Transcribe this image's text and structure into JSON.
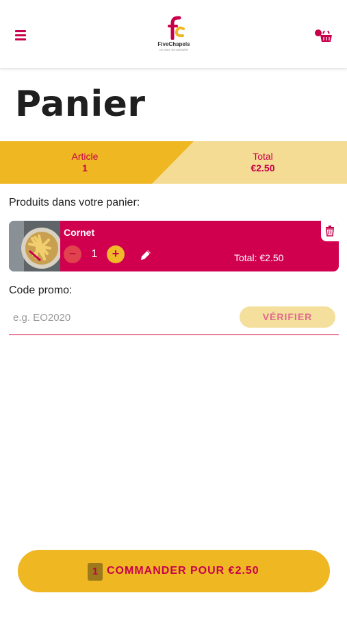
{
  "colors": {
    "brand_primary": "#c8004b",
    "brand_accent": "#efb722",
    "banner_light": "#f5dc94",
    "card_bg": "#d1004f"
  },
  "header": {
    "menu_icon": "hamburger-icon",
    "logo_name": "FiveChapels",
    "logo_tagline": "NO WAY, NO ANSWER",
    "cart_icon": "basket-icon"
  },
  "page": {
    "title": "Panier"
  },
  "summary": {
    "article_label": "Article",
    "article_value": "1",
    "total_label": "Total",
    "total_value": "€2.50"
  },
  "products": {
    "section_label": "Produits dans votre panier:",
    "items": [
      {
        "name": "Cornet",
        "quantity": "1",
        "minus_label": "−",
        "plus_label": "+",
        "total": "Total: €2.50",
        "edit_icon": "pencil-icon",
        "delete_icon": "trash-icon"
      }
    ]
  },
  "promo": {
    "label": "Code promo:",
    "placeholder": "e.g. EO2020",
    "value": "",
    "verify_label": "VÉRIFIER"
  },
  "checkout": {
    "count": "1",
    "label": "COMMANDER POUR €2.50"
  }
}
